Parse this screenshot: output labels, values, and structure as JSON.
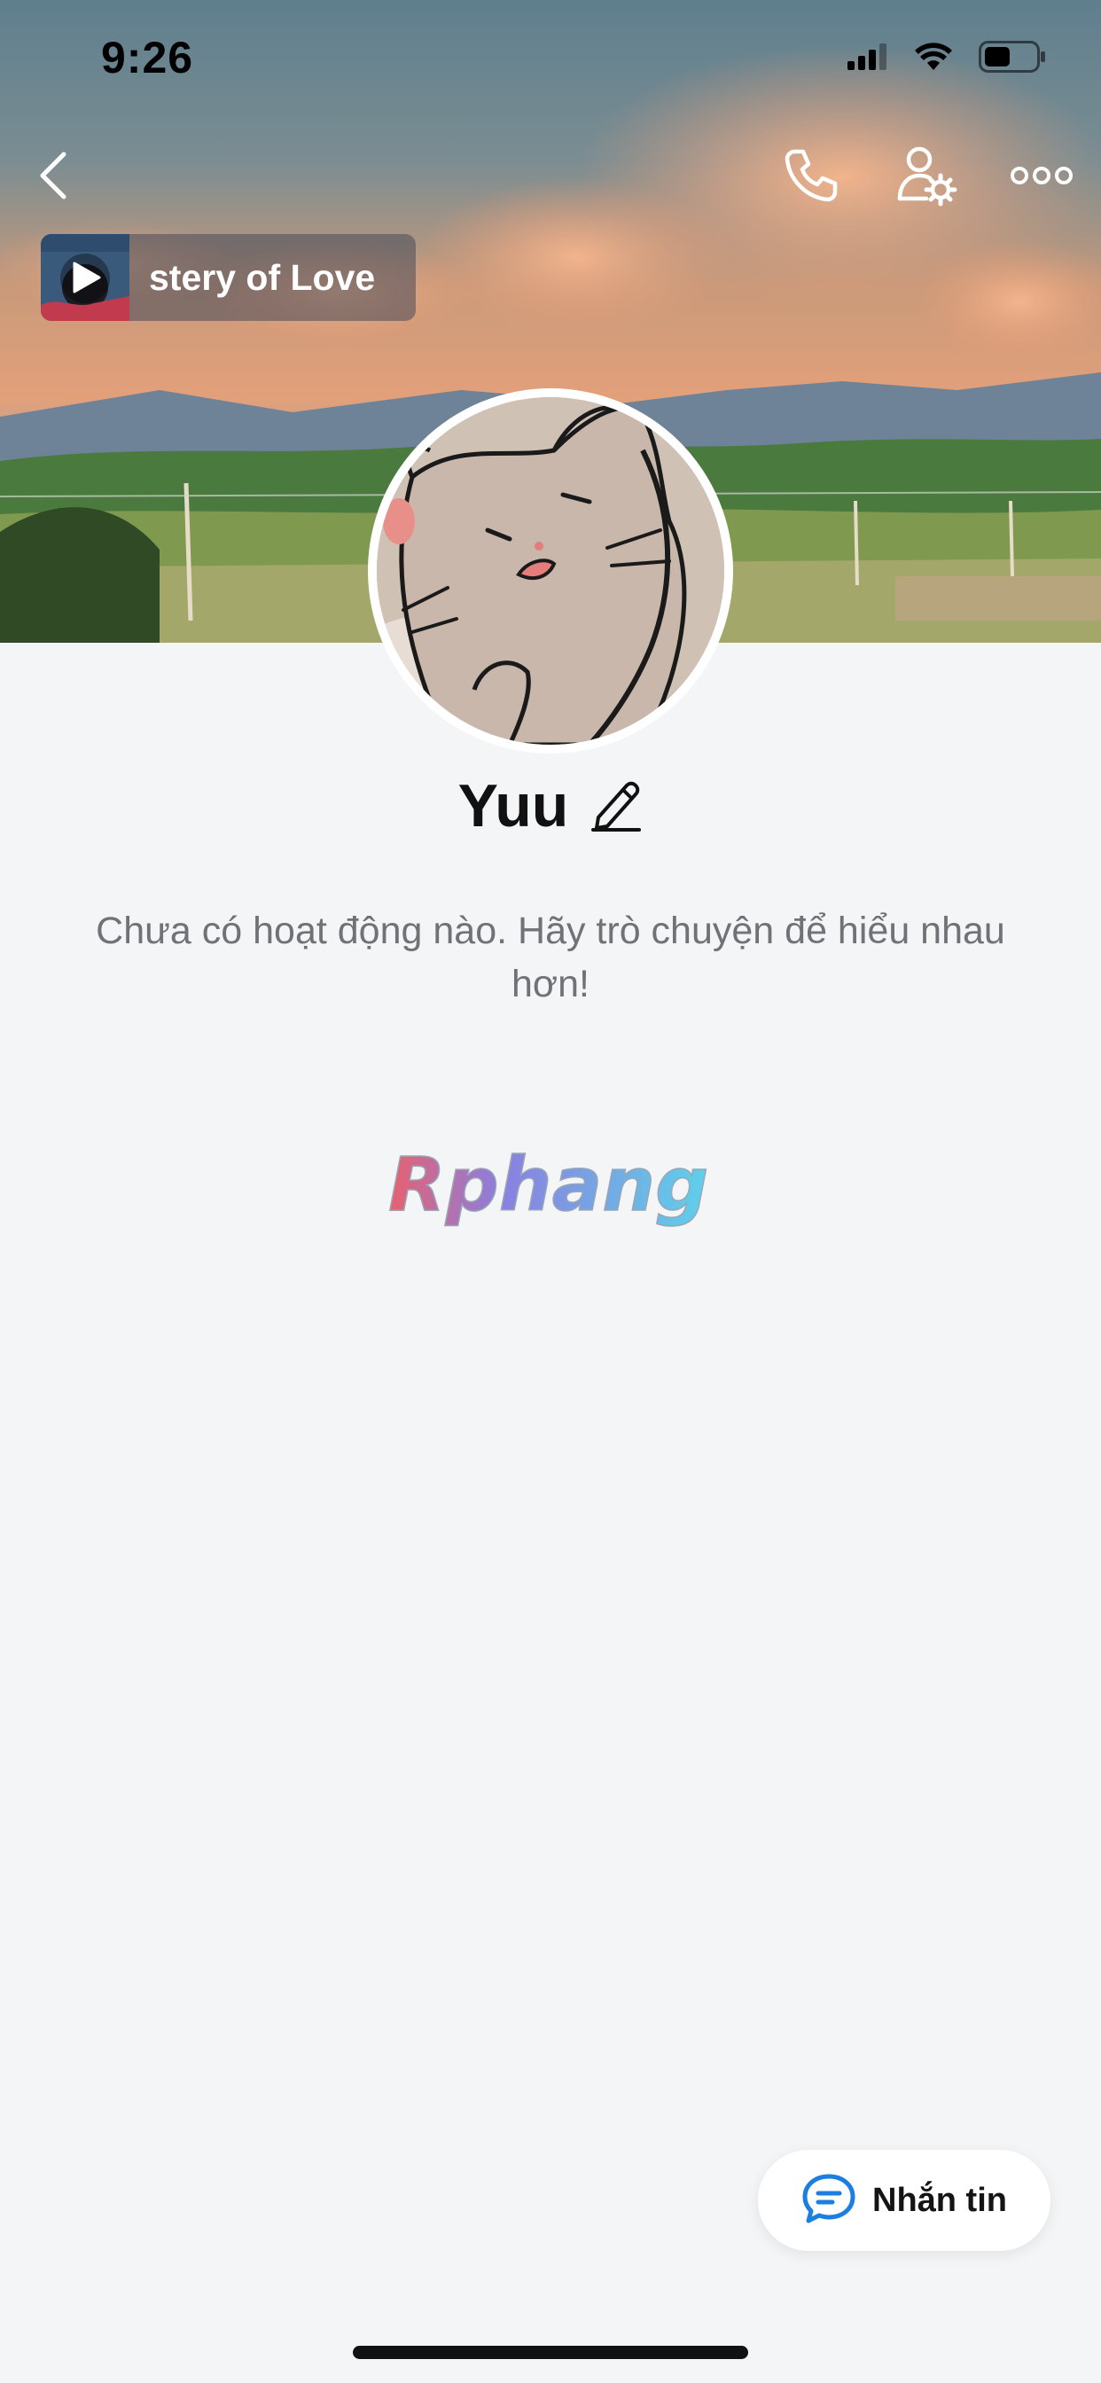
{
  "status_bar": {
    "time": "9:26",
    "icons": [
      "cellular-signal-icon",
      "wifi-icon",
      "battery-icon"
    ]
  },
  "topbar": {
    "icons": [
      "back-chevron-icon",
      "phone-icon",
      "user-settings-icon",
      "more-dots-icon"
    ]
  },
  "music": {
    "title": "stery of Love",
    "icon": "play-icon"
  },
  "profile": {
    "name": "Yuu",
    "edit_icon": "pencil-icon",
    "empty_message": "Chưa có hoạt động nào. Hãy trò chuyện để hiểu nhau hơn!"
  },
  "watermark": {
    "text": "Rphang"
  },
  "chat_button": {
    "label": "Nhắn tin",
    "icon": "chat-bubble-icon"
  },
  "colors": {
    "page_background": "#f4f5f7",
    "chat_icon": "#1a7fe0",
    "secondary_text": "#6f7276"
  }
}
